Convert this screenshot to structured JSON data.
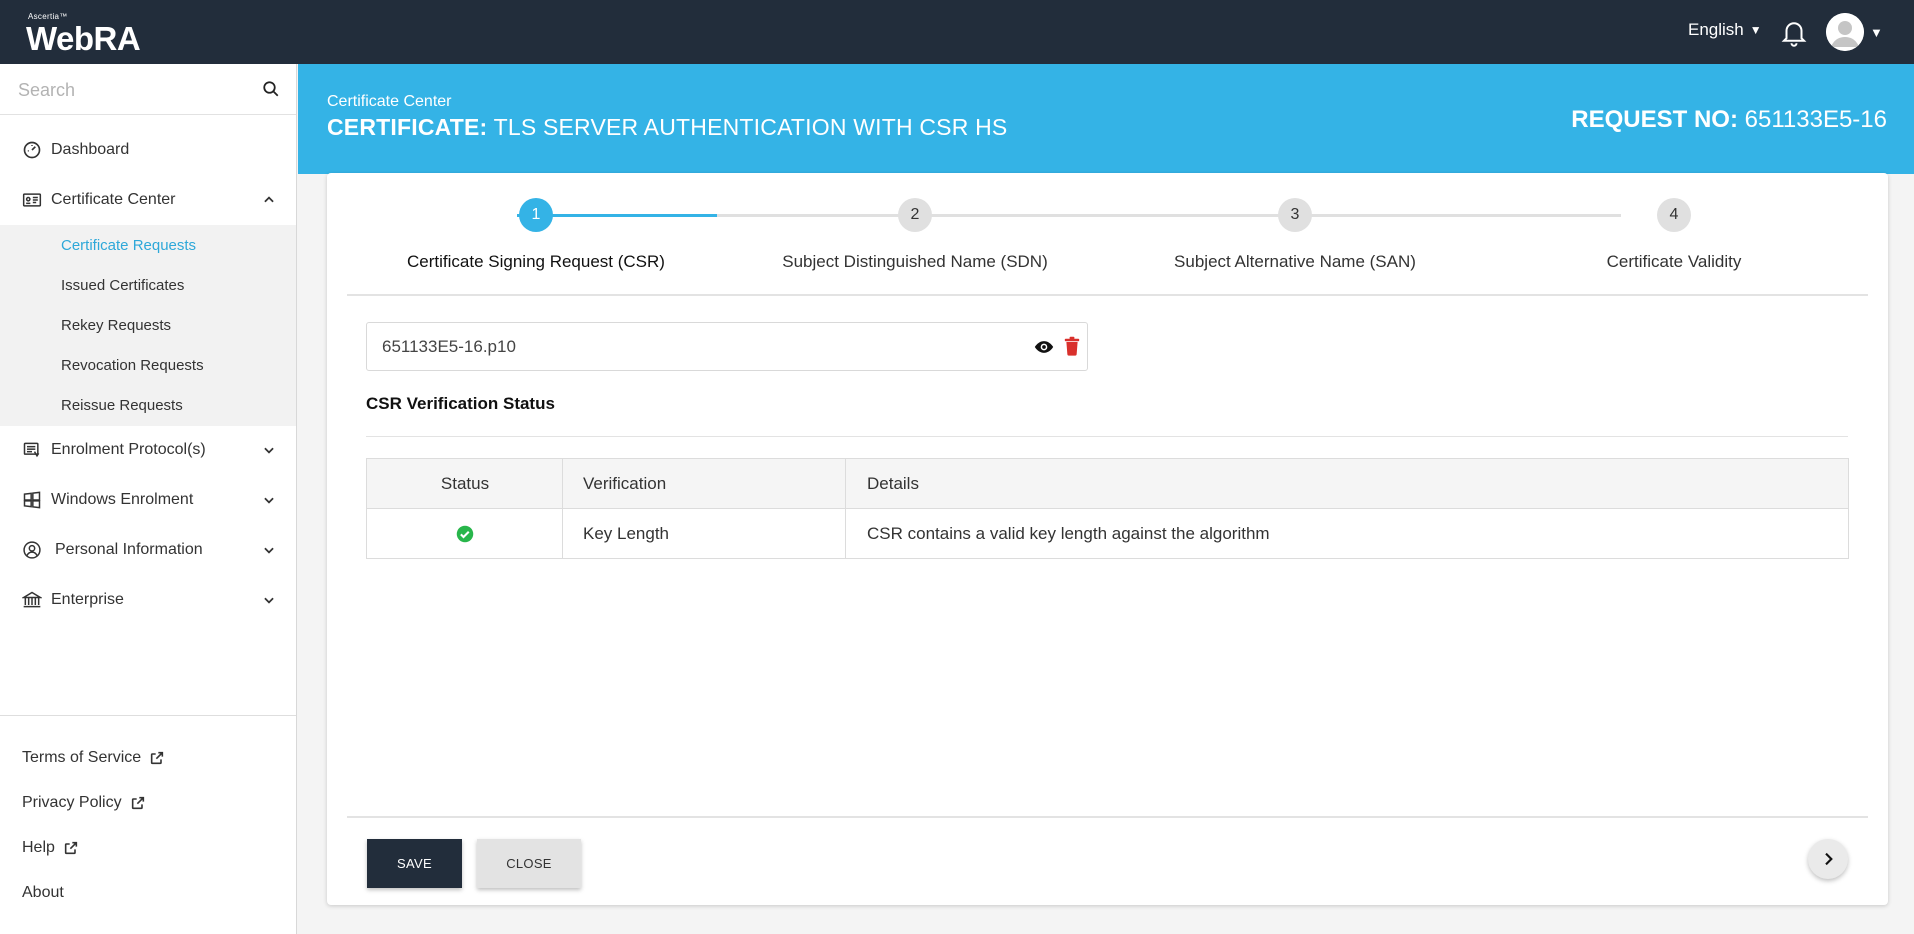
{
  "topbar": {
    "logo_small": "Ascertia™",
    "logo_main": "WebRA",
    "language": "English",
    "icons": [
      "bell-icon",
      "avatar-icon",
      "caret-down-icon"
    ]
  },
  "sidebar": {
    "search_placeholder": "Search",
    "items": [
      {
        "label": "Dashboard",
        "icon": "dashboard-icon"
      },
      {
        "label": "Certificate Center",
        "icon": "certificate-icon"
      },
      {
        "label": "Enrolment Protocol(s)",
        "icon": "protocol-icon"
      },
      {
        "label": "Windows Enrolment",
        "icon": "windows-icon"
      },
      {
        "label": "Personal Information",
        "icon": "user-circle-icon"
      },
      {
        "label": "Enterprise",
        "icon": "bank-icon"
      }
    ],
    "subitems": [
      {
        "label": "Certificate Requests"
      },
      {
        "label": "Issued Certificates"
      },
      {
        "label": "Rekey Requests"
      },
      {
        "label": "Revocation Requests"
      },
      {
        "label": "Reissue Requests"
      }
    ],
    "footer": [
      {
        "label": "Terms of Service"
      },
      {
        "label": "Privacy Policy"
      },
      {
        "label": "Help"
      },
      {
        "label": "About"
      }
    ]
  },
  "header": {
    "breadcrumb": "Certificate Center",
    "title_prefix": "CERTIFICATE:",
    "title": "TLS SERVER AUTHENTICATION WITH CSR HS",
    "request_label": "REQUEST NO:",
    "request_no": "651133E5-16"
  },
  "stepper": {
    "steps": [
      {
        "num": "1",
        "label": "Certificate Signing Request (CSR)"
      },
      {
        "num": "2",
        "label": "Subject Distinguished Name (SDN)"
      },
      {
        "num": "3",
        "label": "Subject Alternative Name (SAN)"
      },
      {
        "num": "4",
        "label": "Certificate Validity"
      }
    ],
    "active_step": 1,
    "accent": "#34b3e6"
  },
  "csr": {
    "file_name": "651133E5-16.p10",
    "section_title": "CSR Verification Status",
    "columns": [
      "Status",
      "Verification",
      "Details"
    ],
    "rows": [
      {
        "status_icon": "check-circle-icon",
        "verification": "Key Length",
        "details": "CSR contains a valid key length against the algorithm"
      }
    ]
  },
  "actions": {
    "save_label": "SAVE",
    "close_label": "CLOSE"
  },
  "colors": {
    "topbar": "#222d3b",
    "banner": "#34b3e6",
    "success": "#28b64b",
    "danger": "#d9302c"
  }
}
